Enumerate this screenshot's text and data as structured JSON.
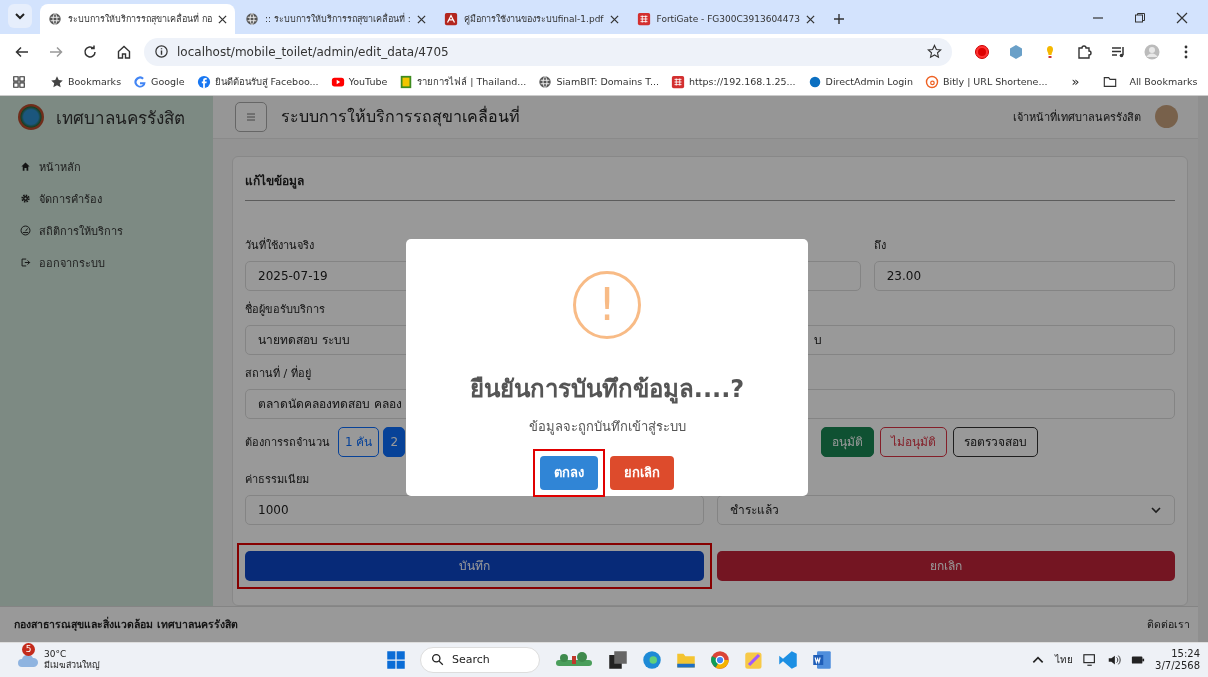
{
  "browser": {
    "tabs": [
      {
        "title": "ระบบการให้บริการรถสุขาเคลื่อนที่ กอ",
        "kind": "globe",
        "selected": true
      },
      {
        "title": ":: ระบบการให้บริการรถสุขาเคลื่อนที่ :",
        "kind": "globe",
        "selected": false
      },
      {
        "title": "คู่มือการใช้งานของระบบfinal-1.pdf",
        "kind": "pdf",
        "selected": false
      },
      {
        "title": "FortiGate - FG300C3913604473",
        "kind": "forti",
        "selected": false
      }
    ],
    "address": "localhost/mobile_toilet/admin/edit_data/4705",
    "bookmarks": [
      {
        "label": "Bookmarks",
        "kind": "star"
      },
      {
        "label": "Google",
        "kind": "google"
      },
      {
        "label": "ยินดีต้อนรับสู่ Faceboo...",
        "kind": "facebook"
      },
      {
        "label": "YouTube",
        "kind": "youtube"
      },
      {
        "label": "รายการไฟล์ | Thailand...",
        "kind": "thai"
      },
      {
        "label": "SiamBIT: Domains T...",
        "kind": "globe"
      },
      {
        "label": "https://192.168.1.25...",
        "kind": "forti"
      },
      {
        "label": "DirectAdmin Login",
        "kind": "dot"
      },
      {
        "label": "Bitly | URL Shortene...",
        "kind": "bitly"
      }
    ],
    "more": "»",
    "all_bookmarks": "All Bookmarks"
  },
  "sidebar": {
    "brand": "เทศบาลนครรังสิต",
    "items": [
      {
        "label": "หน้าหลัก",
        "kind": "home"
      },
      {
        "label": "จัดการคำร้อง",
        "kind": "gear"
      },
      {
        "label": "สถิติการให้บริการ",
        "kind": "gauge"
      },
      {
        "label": "ออกจากระบบ",
        "kind": "logout"
      }
    ]
  },
  "header": {
    "title": "ระบบการให้บริการรถสุขาเคลื่อนที่",
    "user": "เจ้าหน้าที่เทศบาลนครรังสิต"
  },
  "form": {
    "title": "แก้ไขข้อมูล",
    "rows": [
      {
        "fields": [
          {
            "label": "วันที่ใช้งานจริง",
            "value": "2025-07-19",
            "kind": "input"
          },
          {
            "kind": "input"
          },
          {
            "label": "ถึง",
            "value": "23.00",
            "kind": "input"
          }
        ]
      },
      {
        "fields": [
          {
            "label": "ชื่อผู้ขอรับบริการ",
            "value": "นายทดสอบ ระบบ",
            "kind": "input"
          },
          {
            "value_tail": "บ",
            "kind": "input"
          }
        ]
      },
      {
        "fields": [
          {
            "label": "สถานที่ / ที่อยู่",
            "value": "ตลาดนัดคลองทดสอบ คลอง",
            "kind": "input"
          },
          {
            "kind": "input"
          }
        ]
      }
    ],
    "count": {
      "label": "ต้องการรถจำนวน",
      "options": [
        {
          "label": "1 คัน",
          "selected": false
        },
        {
          "label": "2",
          "selected": true
        }
      ]
    },
    "approval": [
      {
        "label": "อนุมัติ",
        "kind": "approve",
        "selected": true
      },
      {
        "label": "ไม่อนุมัติ",
        "kind": "reject",
        "selected": false
      },
      {
        "label": "รอตรวจสอบ",
        "kind": "pending",
        "selected": false
      }
    ],
    "fee_row": {
      "fields": [
        {
          "label": "ค่าธรรมเนียม",
          "value": "1000",
          "kind": "input"
        },
        {
          "value": "ชำระแล้ว",
          "kind": "select"
        }
      ]
    },
    "save": {
      "label": "บันทึก",
      "highlighted": true
    },
    "cancel": {
      "label": "ยกเลิก",
      "highlighted": false
    }
  },
  "footer": {
    "left": "กองสาธารณสุขและสิ่งแวดล้อม เทศบาลนครรังสิต",
    "right": "ติดต่อเรา"
  },
  "dialog": {
    "icon": "!",
    "title": "ยืนยันการบันทึกข้อมูล....?",
    "text": "ข้อมูลจะถูกบันทึกเข้าสู่ระบบ",
    "confirm": {
      "label": "ตกลง",
      "highlighted": true
    },
    "cancel": {
      "label": "ยกเลิก",
      "highlighted": false
    }
  },
  "taskbar": {
    "weather": {
      "badge": "5",
      "temp": "30°C",
      "text": "มีเมฆส่วนใหญ่"
    },
    "search": "Search",
    "lang": "ไทย",
    "time": "15:24",
    "date": "3/7/2568"
  }
}
